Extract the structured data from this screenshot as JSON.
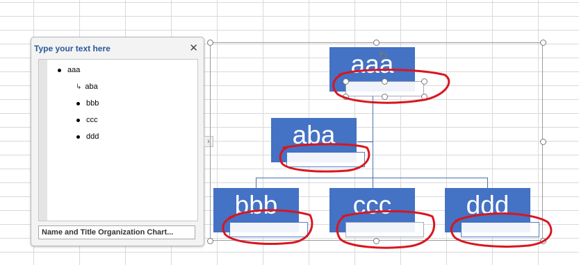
{
  "text_pane": {
    "title": "Type your text here",
    "close_glyph": "✕",
    "items": [
      {
        "label": "aaa",
        "level": 1
      },
      {
        "label": "aba",
        "level": 2
      },
      {
        "label": "bbb",
        "level": 1
      },
      {
        "label": "ccc",
        "level": 1
      },
      {
        "label": "ddd",
        "level": 1
      }
    ],
    "footer": "Name and Title Organization Chart..."
  },
  "expand_glyph": "›",
  "rotate_glyph": "↻",
  "org_chart": {
    "nodes": {
      "top": "aaa",
      "assistant": "aba",
      "child1": "bbb",
      "child2": "ccc",
      "child3": "ddd"
    }
  },
  "colors": {
    "node_fill": "#4472c4",
    "annotation_stroke": "#d9161e",
    "pane_title": "#2b579a"
  }
}
